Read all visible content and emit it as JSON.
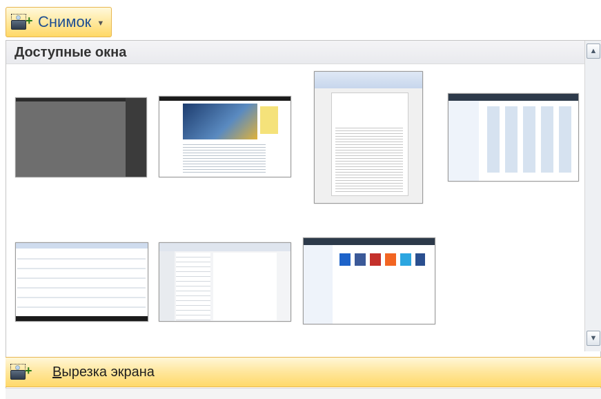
{
  "snapshot_button": {
    "label": "Снимок",
    "icon": "camera-screenshot-icon",
    "caret": "chevron-down-icon"
  },
  "gallery": {
    "header": "Доступные окна",
    "windows": [
      {
        "name": "window-thumbnail-1"
      },
      {
        "name": "window-thumbnail-2"
      },
      {
        "name": "window-thumbnail-3"
      },
      {
        "name": "window-thumbnail-4"
      },
      {
        "name": "window-thumbnail-5"
      },
      {
        "name": "window-thumbnail-6"
      },
      {
        "name": "window-thumbnail-7"
      }
    ]
  },
  "screen_clipping": {
    "label_first": "В",
    "label_rest": "ырезка экрана",
    "icon": "camera-screenshot-icon"
  },
  "colors": {
    "highlight": "#ffe69b",
    "accent_border": "#e8b650",
    "header_bg": "#e9eaee"
  }
}
